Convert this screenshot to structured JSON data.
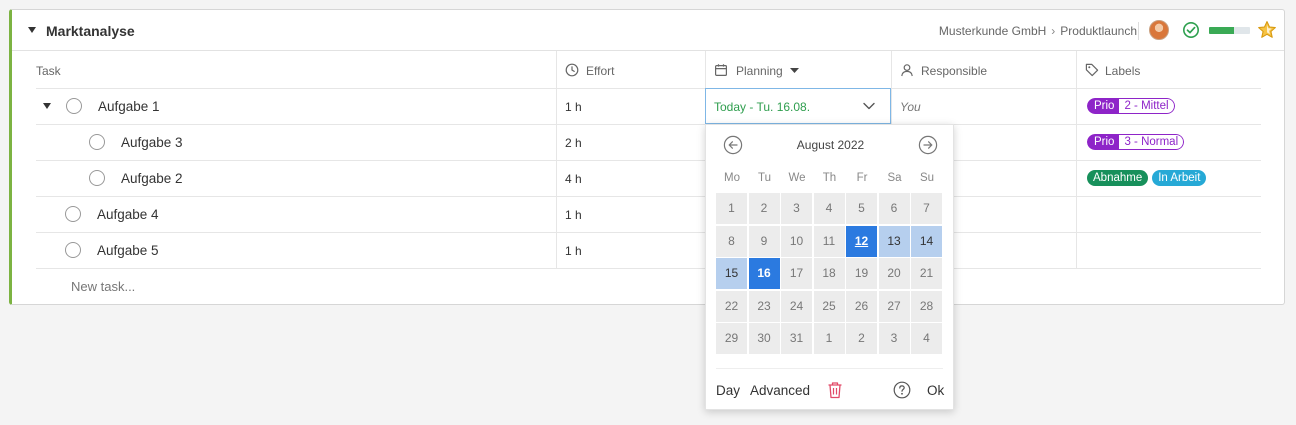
{
  "header": {
    "title": "Marktanalyse",
    "breadcrumb": [
      "Musterkunde GmbH",
      "Produktlaunch"
    ],
    "progress_fraction": 0.6,
    "progress_color": "#3aaa55",
    "accent_color": "#7cb342"
  },
  "columns": {
    "task": "Task",
    "effort": "Effort",
    "planning": "Planning",
    "responsible": "Responsible",
    "labels": "Labels"
  },
  "tasks": [
    {
      "name": "Aufgabe 1",
      "effort": "1 h",
      "responsible": "You",
      "expanded": true
    },
    {
      "name": "Aufgabe 3",
      "effort": "2 h"
    },
    {
      "name": "Aufgabe 2",
      "effort": "4 h"
    },
    {
      "name": "Aufgabe 4",
      "effort": "1 h"
    },
    {
      "name": "Aufgabe 5",
      "effort": "1 h"
    }
  ],
  "labels": {
    "row1": {
      "left": "Prio",
      "right": "2 - Mittel"
    },
    "row2": {
      "left": "Prio",
      "right": "3 - Normal"
    },
    "row3": [
      "Abnahme",
      "In Arbeit"
    ]
  },
  "new_task_placeholder": "New task...",
  "planning_value": "Today - Tu. 16.08.",
  "calendar": {
    "month_label": "August 2022",
    "weekdays": [
      "Mo",
      "Tu",
      "We",
      "Th",
      "Fr",
      "Sa",
      "Su"
    ],
    "weeks": [
      [
        "1",
        "2",
        "3",
        "4",
        "5",
        "6",
        "7"
      ],
      [
        "8",
        "9",
        "10",
        "11",
        "12",
        "13",
        "14"
      ],
      [
        "15",
        "16",
        "17",
        "18",
        "19",
        "20",
        "21"
      ],
      [
        "22",
        "23",
        "24",
        "25",
        "26",
        "27",
        "28"
      ],
      [
        "29",
        "30",
        "31",
        "1",
        "2",
        "3",
        "4"
      ]
    ],
    "today": "12",
    "range_start": "12",
    "range_end": "16",
    "footer": {
      "day": "Day",
      "advanced": "Advanced",
      "ok": "Ok"
    }
  }
}
